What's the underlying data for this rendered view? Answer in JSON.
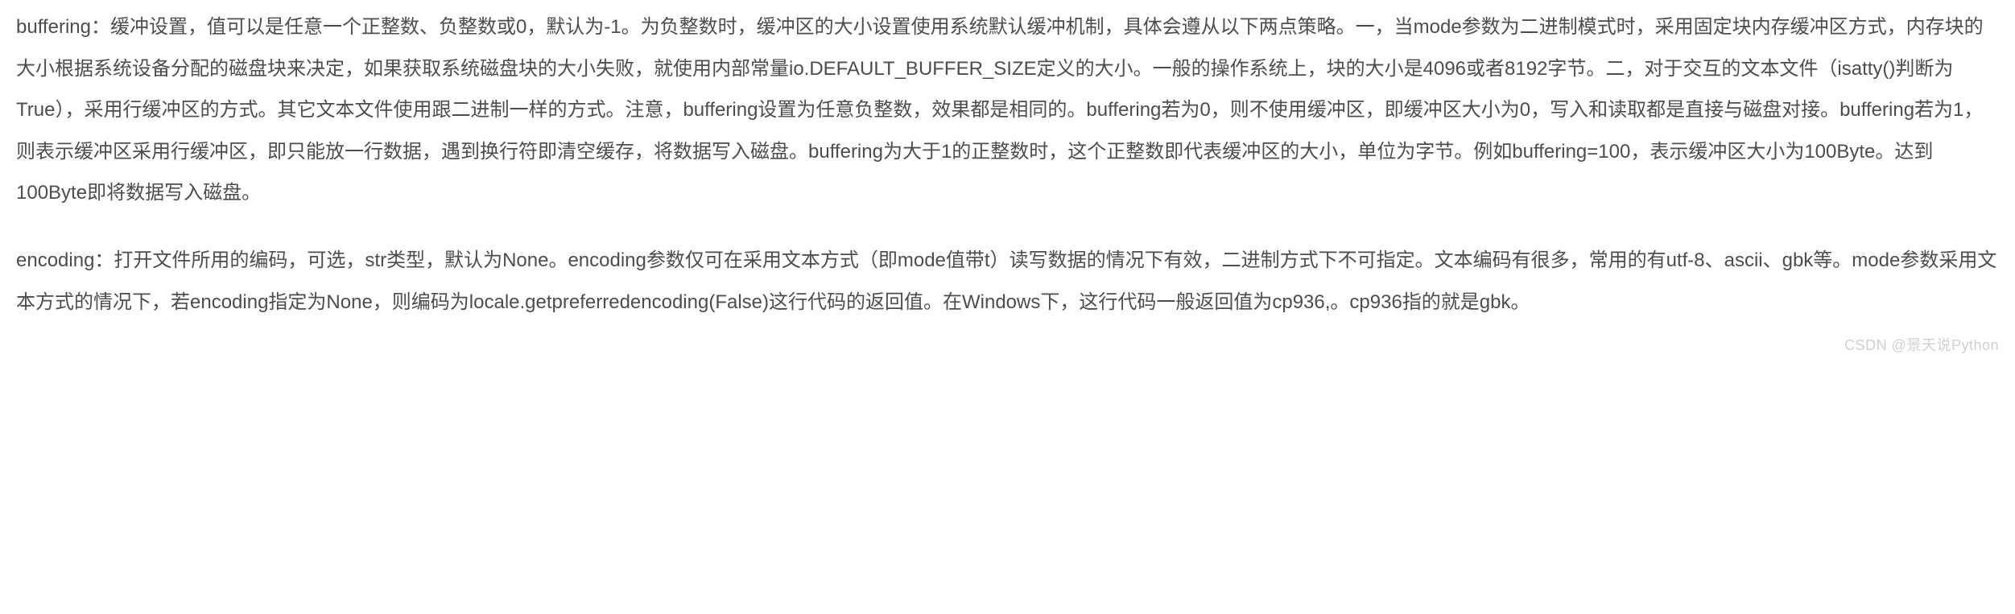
{
  "paragraphs": {
    "p1": "buffering：缓冲设置，值可以是任意一个正整数、负整数或0，默认为-1。为负整数时，缓冲区的大小设置使用系统默认缓冲机制，具体会遵从以下两点策略。一，当mode参数为二进制模式时，采用固定块内存缓冲区方式，内存块的大小根据系统设备分配的磁盘块来决定，如果获取系统磁盘块的大小失败，就使用内部常量io.DEFAULT_BUFFER_SIZE定义的大小。一般的操作系统上，块的大小是4096或者8192字节。二，对于交互的文本文件（isatty()判断为True），采用行缓冲区的方式。其它文本文件使用跟二进制一样的方式。注意，buffering设置为任意负整数，效果都是相同的。buffering若为0，则不使用缓冲区，即缓冲区大小为0，写入和读取都是直接与磁盘对接。buffering若为1，则表示缓冲区采用行缓冲区，即只能放一行数据，遇到换行符即清空缓存，将数据写入磁盘。buffering为大于1的正整数时，这个正整数即代表缓冲区的大小，单位为字节。例如buffering=100，表示缓冲区大小为100Byte。达到100Byte即将数据写入磁盘。",
    "p2": "encoding：打开文件所用的编码，可选，str类型，默认为None。encoding参数仅可在采用文本方式（即mode值带t）读写数据的情况下有效，二进制方式下不可指定。文本编码有很多，常用的有utf-8、ascii、gbk等。mode参数采用文本方式的情况下，若encoding指定为None，则编码为locale.getpreferredencoding(False)这行代码的返回值。在Windows下，这行代码一般返回值为cp936,。cp936指的就是gbk。"
  },
  "watermark": "CSDN @景天说Python"
}
